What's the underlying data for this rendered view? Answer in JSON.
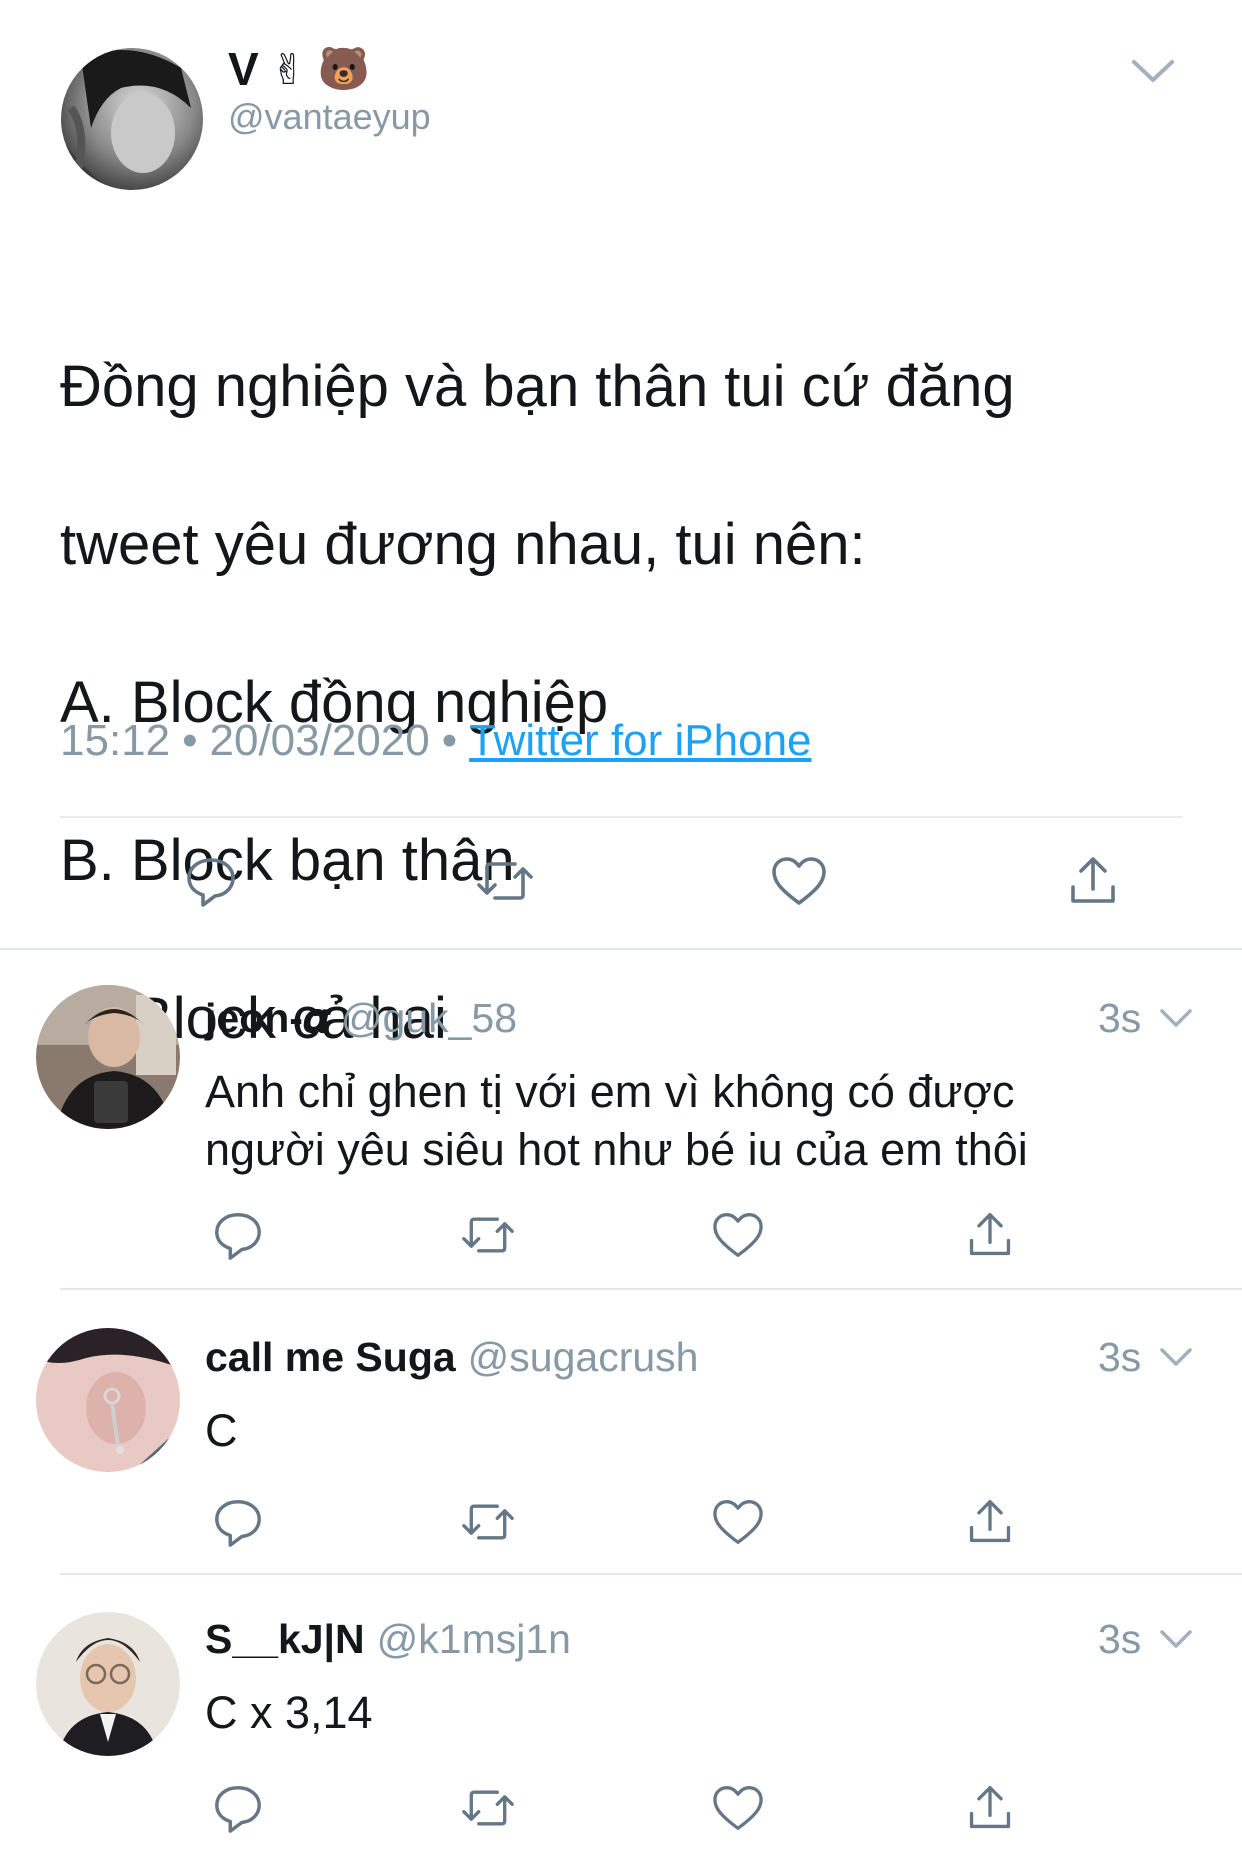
{
  "main_tweet": {
    "display_name": "V",
    "name_emojis": [
      "✌",
      "🐻"
    ],
    "handle": "@vantaeyup",
    "text_lines": [
      "Đồng nghiệp và bạn thân tui cứ đăng",
      "tweet yêu đương nhau, tui nên:",
      "A. Block đồng nghiệp",
      "B. Block bạn thân",
      "C. Block cả hai"
    ],
    "time": "15:12",
    "date": "20/03/2020",
    "separator": "•",
    "source": "Twitter for iPhone"
  },
  "replies": [
    {
      "name": "jeon-𝜶",
      "handle": "@guk_58",
      "time": "3s",
      "text_lines": [
        "Anh chỉ ghen tị với em vì không có được",
        "người yêu siêu hot như bé iu của em thôi"
      ],
      "avatar_icon": "reply-avatar-photo"
    },
    {
      "name": "call me Suga",
      "handle": "@sugacrush",
      "time": "3s",
      "text_lines": [
        "C"
      ],
      "avatar_icon": "reply-avatar-photo"
    },
    {
      "name": "S__kJ|N",
      "handle": "@k1msj1n",
      "time": "3s",
      "text_lines": [
        "C x 3,14"
      ],
      "avatar_icon": "reply-avatar-photo"
    }
  ],
  "action_icons": [
    "reply-icon",
    "retweet-icon",
    "like-icon",
    "share-icon"
  ],
  "colors": {
    "link": "#1da1f2",
    "secondary_text": "#8899a6",
    "icon": "#657786",
    "divider": "#e1e8ed"
  }
}
